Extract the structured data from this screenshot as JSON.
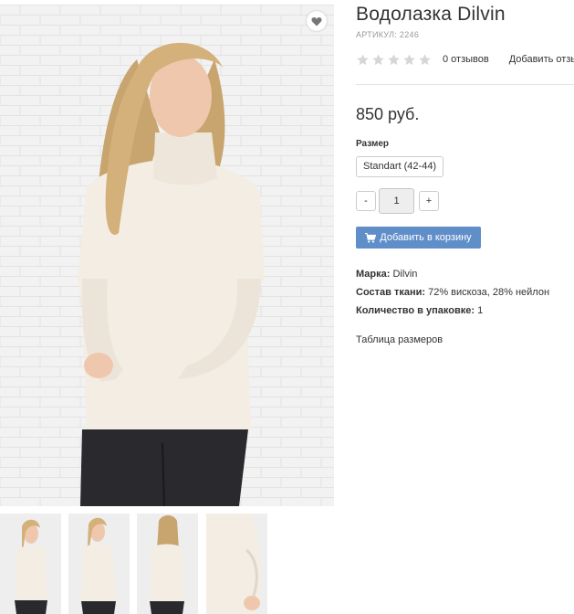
{
  "product": {
    "title": "Водолазка Dilvin",
    "sku": "АРТИКУЛ: 2246",
    "reviews_label": "0 отзывов",
    "add_review_label": "Добавить отзы",
    "rating": 0,
    "rating_max": 5,
    "price": "850 руб.",
    "size_label": "Размер",
    "size_option": "Standart (42-44)",
    "qty_minus": "-",
    "qty_value": "1",
    "qty_plus": "+",
    "add_to_cart": "Добавить в корзину",
    "props": [
      {
        "key": "Марка:",
        "value": "Dilvin"
      },
      {
        "key": "Состав ткани:",
        "value": "72% вискоза, 28% нейлон"
      },
      {
        "key": "Количество в упаковке:",
        "value": "1"
      }
    ],
    "size_table_link": "Таблица размеров"
  },
  "icons": {
    "wishlist": "heart-icon",
    "star": "star-icon",
    "cart": "shopping-cart-icon"
  },
  "colors": {
    "accent": "#5f8ec8",
    "star_empty": "#d6d6d6",
    "sweater": "#f3ede3"
  }
}
